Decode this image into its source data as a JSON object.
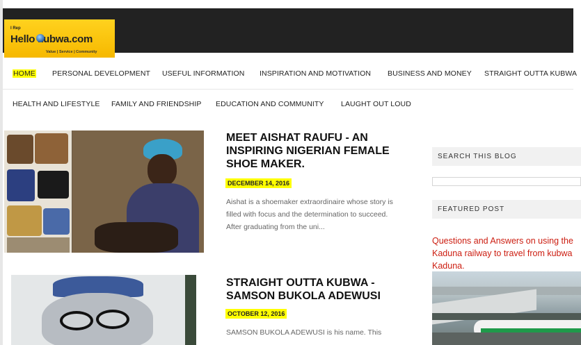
{
  "logo": {
    "small": "I Rep",
    "brand": "Hello kubwa.com",
    "tagline": "Value | Service | Community"
  },
  "nav": {
    "row1": [
      "HOME",
      "PERSONAL DEVELOPMENT",
      "USEFUL INFORMATION",
      "INSPIRATION AND MOTIVATION",
      "BUSINESS AND MONEY",
      "STRAIGHT OUTTA KUBWA"
    ],
    "row2": [
      "HEALTH AND LIFESTYLE",
      "FAMILY AND FRIENDSHIP",
      "EDUCATION AND COMMUNITY",
      "LAUGHT OUT LOUD"
    ],
    "active": "HOME"
  },
  "posts": [
    {
      "title": "MEET AISHAT RAUFU - AN INSPIRING NIGERIAN FEMALE SHOE MAKER.",
      "date": "DECEMBER 14, 2016",
      "snippet": "Aishat is a shoemaker extraordinaire whose story is filled with focus and the determination to succeed. After graduating from the uni..."
    },
    {
      "title": "STRAIGHT OUTTA KUBWA - SAMSON BUKOLA ADEWUSI",
      "date": "OCTOBER 12, 2016",
      "snippet": "SAMSON BUKOLA ADEWUSI is his name. This"
    }
  ],
  "sidebar": {
    "search_heading": "SEARCH THIS BLOG",
    "search_value": "",
    "featured_heading": "FEATURED POST",
    "featured_title": "Questions and Answers on using the Kaduna railway to travel from kubwa Kaduna."
  },
  "colors": {
    "accent_yellow": "#ffff00",
    "featured_red": "#cc1d10",
    "topbar": "#222222"
  }
}
